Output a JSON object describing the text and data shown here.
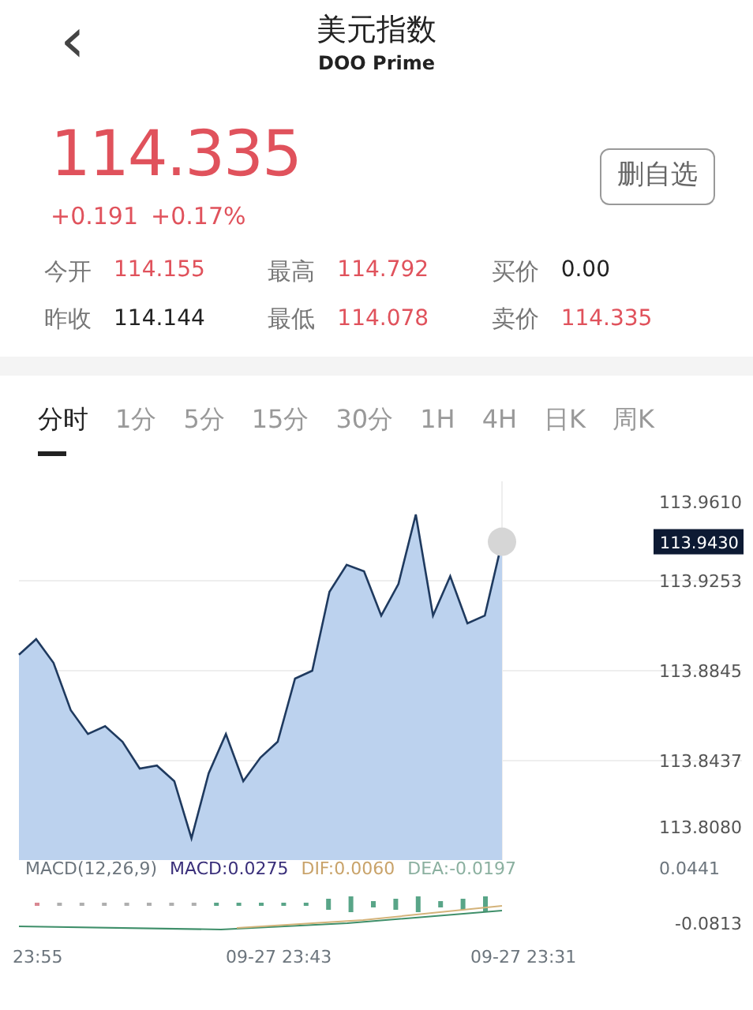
{
  "header": {
    "back_icon": "‹",
    "title": "美元指数",
    "subtitle": "DOO Prime"
  },
  "quote": {
    "price": "114.335",
    "change": "+0.191",
    "change_pct": "+0.17%",
    "button": "删自选"
  },
  "stats": [
    {
      "label": "今开",
      "value": "114.155",
      "color": "#e0525c"
    },
    {
      "label": "最高",
      "value": "114.792",
      "color": "#e0525c"
    },
    {
      "label": "买价",
      "value": "0.00",
      "color": "#222222"
    },
    {
      "label": "昨收",
      "value": "114.144",
      "color": "#222222"
    },
    {
      "label": "最低",
      "value": "114.078",
      "color": "#e0525c"
    },
    {
      "label": "卖价",
      "value": "114.335",
      "color": "#e0525c"
    }
  ],
  "tabs": [
    {
      "label": "分时",
      "selected": true
    },
    {
      "label": "1分",
      "selected": false
    },
    {
      "label": "5分",
      "selected": false
    },
    {
      "label": "15分",
      "selected": false
    },
    {
      "label": "30分",
      "selected": false
    },
    {
      "label": "1H",
      "selected": false
    },
    {
      "label": "4H",
      "selected": false
    },
    {
      "label": "日K",
      "selected": false
    },
    {
      "label": "周K",
      "selected": false
    }
  ],
  "price_chart": {
    "last_price_label": "113.9430",
    "chart_data": {
      "type": "area",
      "grid": true,
      "ylim": [
        113.7986,
        113.9704
      ],
      "yticks": [
        {
          "value": 113.961,
          "label": "113.9610"
        },
        {
          "value": 113.9253,
          "label": "113.9253"
        },
        {
          "value": 113.8845,
          "label": "113.8845"
        },
        {
          "value": 113.8437,
          "label": "113.8437"
        },
        {
          "value": 113.808,
          "label": "113.8080"
        }
      ],
      "series": [
        {
          "color": "#1f3a5f",
          "values": [
            113.8917,
            113.8988,
            113.8881,
            113.8666,
            113.8558,
            113.8594,
            113.8523,
            113.8401,
            113.8415,
            113.8344,
            113.8085,
            113.838,
            113.8558,
            113.8344,
            113.8451,
            113.8523,
            113.8809,
            113.8845,
            113.9203,
            113.9325,
            113.9296,
            113.9095,
            113.9239,
            113.9554,
            113.9095,
            113.9274,
            113.906,
            113.9095,
            113.943
          ]
        }
      ]
    }
  },
  "macd": {
    "title": "MACD(12,26,9)",
    "macd": "MACD:0.0275",
    "dif": "DIF:0.0060",
    "dea": "DEA:-0.0197",
    "top_label": "0.0441",
    "bottom_label": "-0.0813"
  },
  "time_axis": [
    "23:55",
    "09-27 23:43",
    "09-27 23:31"
  ]
}
